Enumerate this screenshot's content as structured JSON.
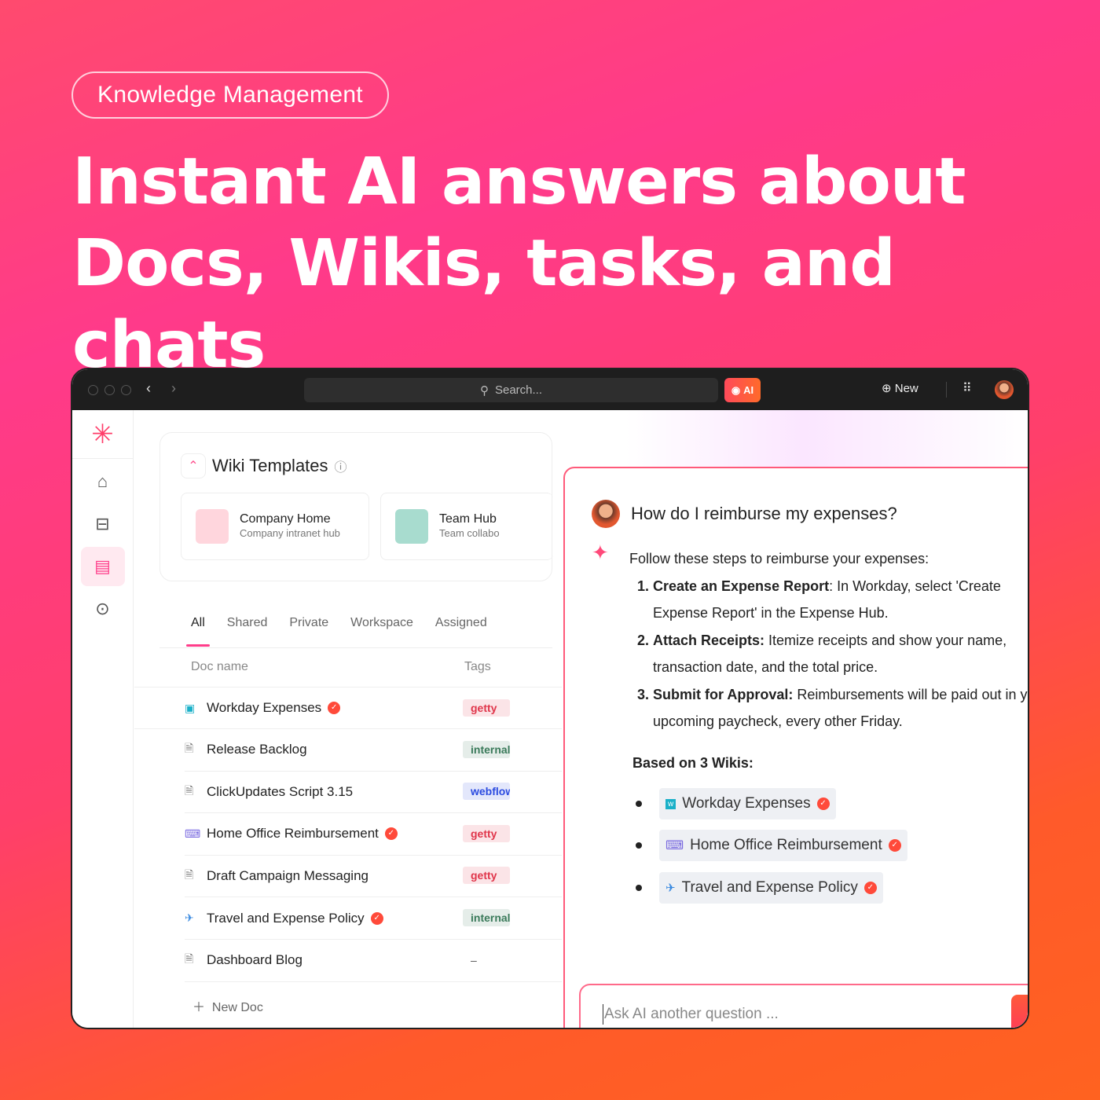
{
  "badge": "Knowledge Management",
  "headline": [
    "Instant AI answers about",
    "Docs, Wikis, tasks, and chats"
  ],
  "colors": {
    "accent": "#ff3d8a",
    "verified": "#ff4a3a",
    "titlebar": "#1e1e1e"
  },
  "titlebar": {
    "search_placeholder": "Search...",
    "ai_label": "AI",
    "new_label": "New"
  },
  "sidebar": {
    "icons": [
      "clickup-logo-icon",
      "home-icon",
      "inbox-icon",
      "docs-icon",
      "more-icon"
    ]
  },
  "templates": {
    "title": "Wiki Templates",
    "items": [
      {
        "name": "Company Home",
        "desc": "Company intranet hub"
      },
      {
        "name": "Team Hub",
        "desc": "Team collabo"
      }
    ]
  },
  "tabs": [
    "All",
    "Shared",
    "Private",
    "Workspace",
    "Assigned"
  ],
  "columns": {
    "name": "Doc name",
    "tags": "Tags"
  },
  "docs": [
    {
      "name": "Workday Expenses",
      "verified": true,
      "icon": "workday-icon",
      "tag": "getty",
      "tag_color": "#e0354a"
    },
    {
      "name": "Release Backlog",
      "verified": false,
      "icon": "doc-icon",
      "tag": "internal",
      "tag_color": "#3a7a5a"
    },
    {
      "name": "ClickUpdates Script 3.15",
      "verified": false,
      "icon": "doc-icon",
      "tag": "webflow",
      "tag_color": "#2a4ae0"
    },
    {
      "name": "Home Office Reimbursement",
      "verified": true,
      "icon": "keyboard-icon",
      "tag": "getty",
      "tag_color": "#e0354a"
    },
    {
      "name": "Draft Campaign Messaging",
      "verified": false,
      "icon": "doc-icon",
      "tag": "getty",
      "tag_color": "#e0354a"
    },
    {
      "name": "Travel and Expense Policy",
      "verified": true,
      "icon": "plane-icon",
      "tag": "internal",
      "tag_color": "#3a7a5a"
    },
    {
      "name": "Dashboard Blog",
      "verified": false,
      "icon": "doc-icon",
      "tag": "–",
      "tag_color": ""
    }
  ],
  "new_doc": "New Doc",
  "ai": {
    "question": "How do I reimburse my expenses?",
    "intro": "Follow these steps to reimburse your expenses:",
    "steps": [
      {
        "title": "Create an Expense Report",
        "text": ": In Workday, select 'Create Expense Report' in the Expense Hub."
      },
      {
        "title": "Attach Receipts:",
        "text": " Itemize receipts and show your name, transaction date, and the total price."
      },
      {
        "title": "Submit for Approval:",
        "text": "  Reimbursements will be paid out in your upcoming paycheck, every other Friday."
      }
    ],
    "based_on": "Based on 3 Wikis:",
    "sources": [
      "Workday Expenses",
      "Home Office Reimbursement",
      "Travel and Expense Policy"
    ],
    "input_placeholder": "Ask AI another question ..."
  }
}
